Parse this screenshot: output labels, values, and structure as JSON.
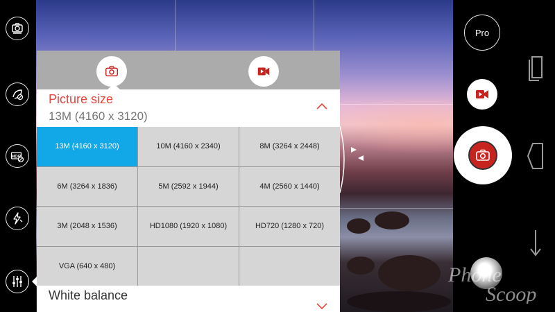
{
  "left_toolbar": {
    "items": [
      {
        "name": "camera-mode",
        "icon": "camera-switch-icon"
      },
      {
        "name": "beautify",
        "icon": "beautify-off-icon"
      },
      {
        "name": "hdr",
        "icon": "hdr-off-icon"
      },
      {
        "name": "flash",
        "icon": "flash-off-icon"
      },
      {
        "name": "settings",
        "icon": "sliders-icon"
      }
    ]
  },
  "right_controls": {
    "pro_label": "Pro",
    "video_icon": "video-camera-icon",
    "shutter_icon": "camera-icon"
  },
  "settings_panel": {
    "tabs": [
      {
        "name": "photo",
        "icon": "camera-icon"
      },
      {
        "name": "video",
        "icon": "video-camera-icon"
      }
    ],
    "picture_size": {
      "title": "Picture size",
      "value": "13M (4160 x 3120)",
      "options": [
        "13M (4160 x 3120)",
        "10M (4160 x 2340)",
        "8M (3264 x 2448)",
        "6M (3264 x 1836)",
        "5M (2592 x 1944)",
        "4M (2560 x 1440)",
        "3M (2048 x 1536)",
        "HD1080 (1920 x 1080)",
        "HD720 (1280 x 720)",
        "VGA (640 x 480)",
        "",
        ""
      ],
      "selected_index": 0
    },
    "white_balance": {
      "title": "White balance"
    }
  },
  "colors": {
    "accent": "#e5473f",
    "selected": "#12a8e8",
    "shutter": "#c8241f"
  }
}
